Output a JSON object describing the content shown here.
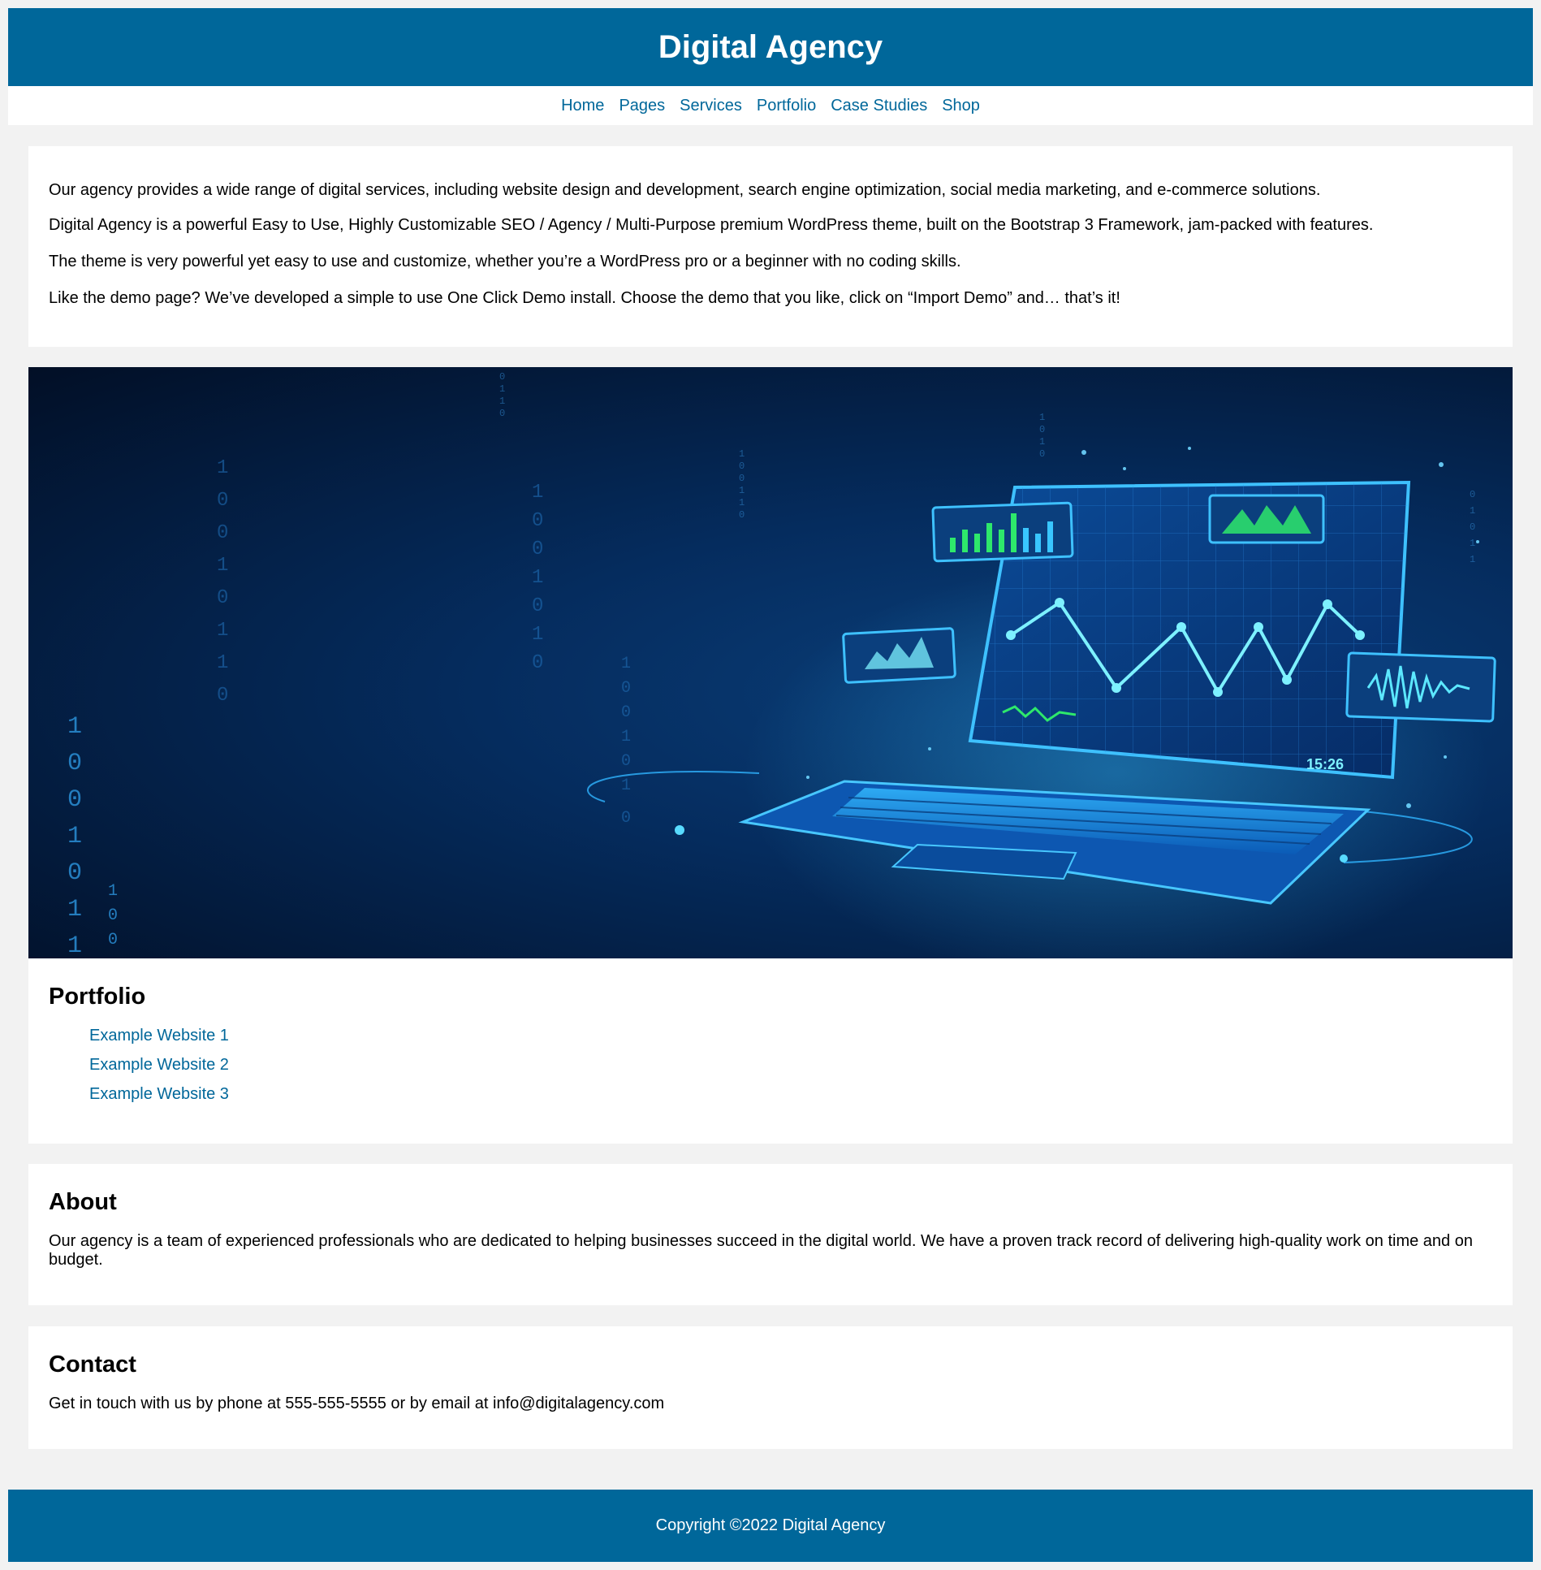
{
  "site": {
    "title": "Digital Agency"
  },
  "nav": {
    "items": [
      {
        "label": "Home"
      },
      {
        "label": "Pages"
      },
      {
        "label": "Services"
      },
      {
        "label": "Portfolio"
      },
      {
        "label": "Case Studies"
      },
      {
        "label": "Shop"
      }
    ]
  },
  "intro": {
    "paragraphs": [
      "Our agency provides a wide range of digital services, including website design and development, search engine optimization, social media marketing, and e-commerce solutions.",
      "Digital Agency is a powerful Easy to Use, Highly Customizable SEO / Agency / Multi-Purpose premium WordPress theme, built on the Bootstrap 3 Framework, jam-packed with features.",
      "The theme is very powerful yet easy to use and customize, whether you’re a WordPress pro or a beginner with no coding skills.",
      "Like the demo page? We’ve developed a simple to use One Click Demo install. Choose the demo that you like, click on “Import Demo” and… that’s it!"
    ]
  },
  "hero": {
    "image": "laptop-analytics-illustration",
    "clock_text": "15:26",
    "colors": {
      "background": "#03224a",
      "glow": "#39c6ff",
      "green": "#2ee86b"
    }
  },
  "portfolio": {
    "heading": "Portfolio",
    "items": [
      {
        "label": "Example Website 1"
      },
      {
        "label": "Example Website 2"
      },
      {
        "label": "Example Website 3"
      }
    ]
  },
  "about": {
    "heading": "About",
    "text": "Our agency is a team of experienced professionals who are dedicated to helping businesses succeed in the digital world. We have a proven track record of delivering high-quality work on time and on budget."
  },
  "contact": {
    "heading": "Contact",
    "text": "Get in touch with us by phone at 555-555-5555 or by email at info@digitalagency.com"
  },
  "footer": {
    "text": "Copyright ©2022 Digital Agency"
  },
  "colors": {
    "brand": "#00679a",
    "page_bg": "#f2f2f2",
    "card_bg": "#ffffff"
  }
}
